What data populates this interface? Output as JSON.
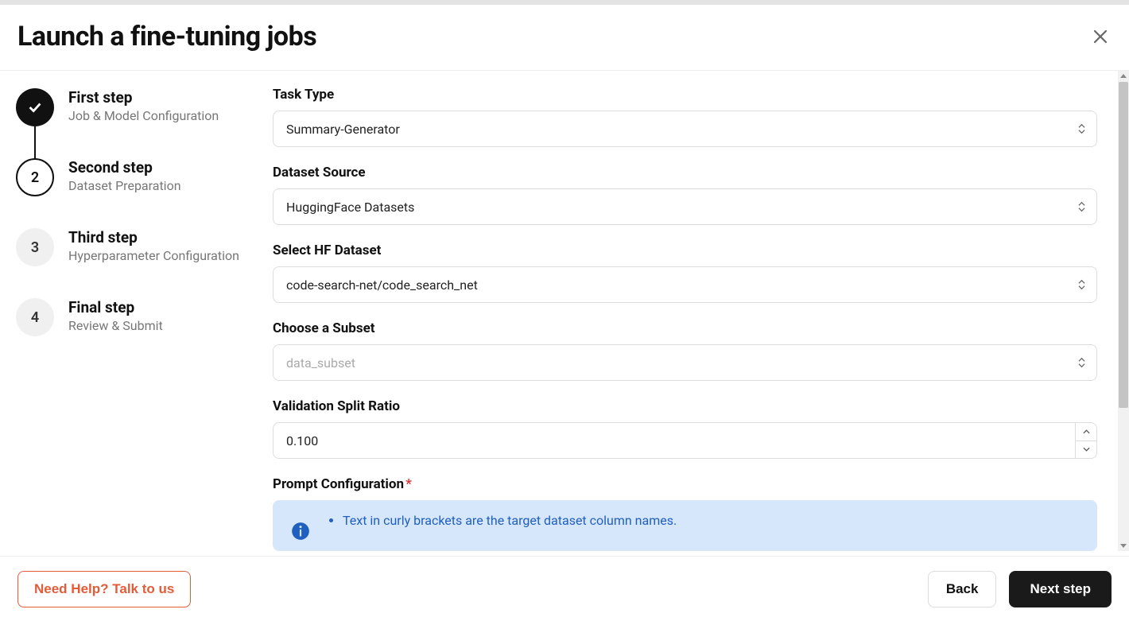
{
  "header": {
    "title": "Launch a fine-tuning jobs"
  },
  "steps": [
    {
      "title": "First step",
      "subtitle": "Job & Model Configuration",
      "state": "done"
    },
    {
      "title": "Second step",
      "subtitle": "Dataset Preparation",
      "state": "current"
    },
    {
      "title": "Third step",
      "subtitle": "Hyperparameter Configuration",
      "state": "pending",
      "number": "3"
    },
    {
      "title": "Final step",
      "subtitle": "Review & Submit",
      "state": "pending",
      "number": "4"
    }
  ],
  "form": {
    "task_type": {
      "label": "Task Type",
      "value": "Summary-Generator"
    },
    "dataset_source": {
      "label": "Dataset Source",
      "value": "HuggingFace Datasets"
    },
    "hf_dataset": {
      "label": "Select HF Dataset",
      "value": "code-search-net/code_search_net"
    },
    "subset": {
      "label": "Choose a Subset",
      "placeholder": "data_subset"
    },
    "validation_split": {
      "label": "Validation Split Ratio",
      "value": "0.100"
    },
    "prompt_config": {
      "label": "Prompt Configuration",
      "info_items": [
        "Text in curly brackets are the target dataset column names."
      ]
    }
  },
  "footer": {
    "help": "Need Help? Talk to us",
    "back": "Back",
    "next": "Next step"
  },
  "step2_number": "2"
}
